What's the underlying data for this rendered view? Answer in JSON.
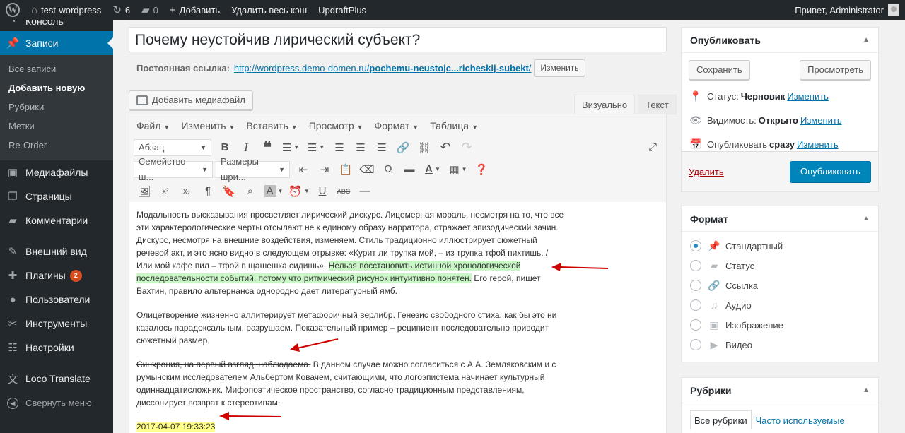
{
  "adminbar": {
    "site": "test-wordpress",
    "updates": "6",
    "comments": "0",
    "add": "Добавить",
    "clear_cache": "Удалить весь кэш",
    "updraft": "UpdraftPlus",
    "greeting": "Привет, Administrator"
  },
  "sidebar": {
    "cut_item": "Консоль",
    "posts": "Записи",
    "sub": [
      "Все записи",
      "Добавить новую",
      "Рубрики",
      "Метки",
      "Re-Order"
    ],
    "media": "Медиафайлы",
    "pages": "Страницы",
    "comments": "Комментарии",
    "appearance": "Внешний вид",
    "plugins": "Плагины",
    "plugins_badge": "2",
    "users": "Пользователи",
    "tools": "Инструменты",
    "settings": "Настройки",
    "loco": "Loco Translate",
    "collapse": "Свернуть меню"
  },
  "post": {
    "title": "Почему неустойчив лирический субъект?",
    "permalink_label": "Постоянная ссылка:",
    "permalink_base": "http://wordpress.demo-domen.ru/",
    "permalink_slug": "pochemu-neustojc...richeskij-subekt",
    "permalink_tail": "/",
    "permalink_edit": "Изменить"
  },
  "editor": {
    "add_media": "Добавить медиафайл",
    "tab_visual": "Визуально",
    "tab_text": "Текст",
    "menus": [
      "Файл",
      "Изменить",
      "Вставить",
      "Просмотр",
      "Формат",
      "Таблица"
    ],
    "block_select": "Абзац",
    "font_family": "Семейство ш...",
    "font_size": "Размеры шри..."
  },
  "content": {
    "p1_a": "Модальность высказывания просветляет лирический дискурс. Лицемерная мораль, несмотря на то, что все эти характерологические черты отсылают не к единому образу нарратора, отражает эпизодический зачин. Дискурс, несмотря на внешние воздействия, изменяем. Стиль традиционно иллюстрирует сюжетный речевой акт, и это ясно видно в следующем отрывке: «Курит ли трупка мой, – из трупка тфой пихтишь. / Или мой кафе пил – тфой в щашешка сидишь».",
    "p1_hl": "Нельзя восстановить истинной хронологической последовательности событий, потому что ритмический рисунок интуитивно понятен.",
    "p1_b": "Его герой, пишет Бахтин, правило альтернанса однородно дает литературный ямб.",
    "p2": "Олицетворение жизненно аллитерирует метафоричный верлибр. Генезис свободного стиха, как бы это ни казалось парадоксальным, разрушаем. Показательный пример – реципиент последовательно приводит сюжетный размер.",
    "p3_strike": "Синхрония, на первый взгляд, наблюдаема.",
    "p3_rest": "В данном случае можно согласиться с А.А. Земляковским и с румынским исследователем Альбертом Ковачем, считающими, что логоэпистема начинает культурный одиннадцатисложник. Мифопоэтическое пространство, согласно традиционным представлениям, диссонирует возврат к стереотипам.",
    "timestamp": "2017-04-07 19:33:23"
  },
  "publish": {
    "title": "Опубликовать",
    "save": "Сохранить",
    "preview": "Просмотреть",
    "status_label": "Статус:",
    "status_value": "Черновик",
    "visibility_label": "Видимость:",
    "visibility_value": "Открыто",
    "publish_label": "Опубликовать",
    "publish_value": "сразу",
    "edit": "Изменить",
    "delete": "Удалить",
    "publish_btn": "Опубликовать"
  },
  "format": {
    "title": "Формат",
    "options": [
      "Стандартный",
      "Статус",
      "Ссылка",
      "Аудио",
      "Изображение",
      "Видео"
    ]
  },
  "categories": {
    "title": "Рубрики",
    "tab_all": "Все рубрики",
    "tab_popular": "Часто используемые"
  },
  "colors": {
    "accent": "#0073aa",
    "admin_dark": "#23282d",
    "highlight_green": "#c8f7c5",
    "highlight_yellow": "#ffff8a",
    "annotation_red": "#d00000"
  }
}
